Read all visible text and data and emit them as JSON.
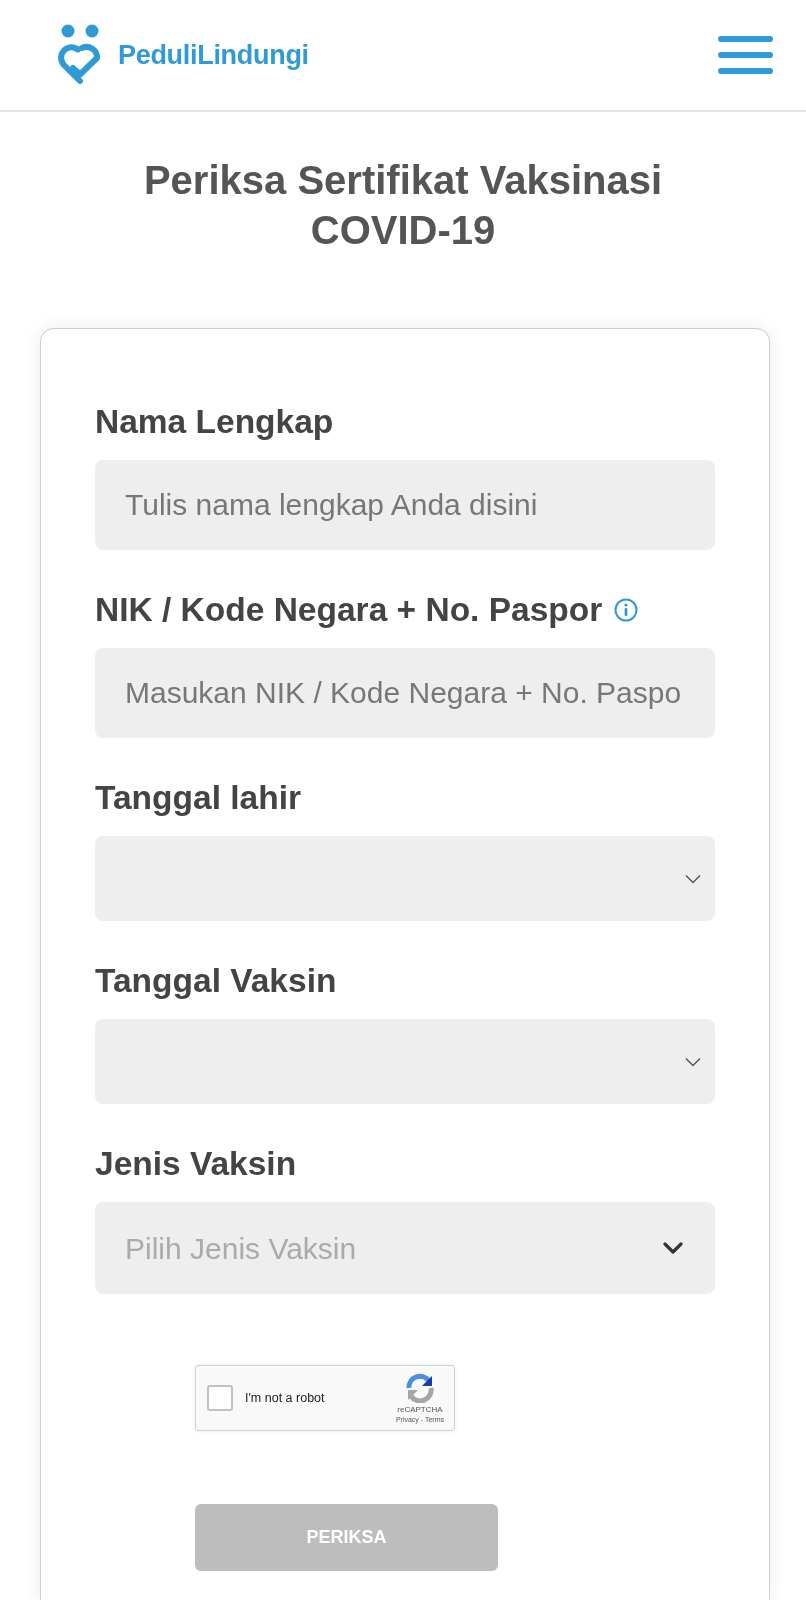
{
  "header": {
    "logo_text": "PeduliLindungi"
  },
  "title": "Periksa Sertifikat Vaksinasi COVID-19",
  "form": {
    "fields": [
      {
        "kind": "text",
        "label": "Nama Lengkap",
        "info": false,
        "placeholder": "Tulis nama lengkap Anda disini"
      },
      {
        "kind": "text",
        "label": "NIK / Kode Negara + No. Paspor",
        "info": true,
        "placeholder": "Masukan NIK / Kode Negara + No. Paspo"
      },
      {
        "kind": "date",
        "label": "Tanggal lahir",
        "info": false
      },
      {
        "kind": "date",
        "label": "Tanggal Vaksin",
        "info": false
      },
      {
        "kind": "select",
        "label": "Jenis Vaksin",
        "info": false,
        "placeholder": "Pilih Jenis Vaksin"
      }
    ],
    "captcha": {
      "label": "I'm not a robot",
      "checked": false,
      "brand": "reCAPTCHA",
      "links": "Privacy - Terms"
    },
    "submit": {
      "label": "PERIKSA",
      "disabled": true
    }
  }
}
